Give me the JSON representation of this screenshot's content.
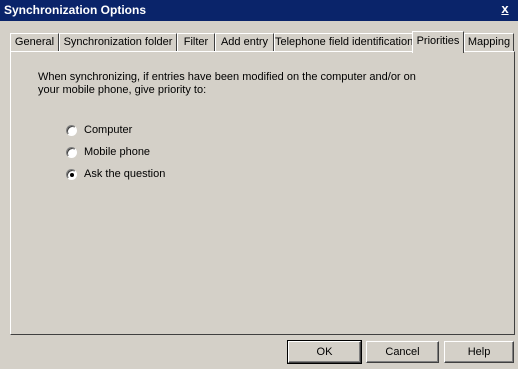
{
  "window": {
    "title": "Synchronization Options",
    "close_glyph": "x"
  },
  "tabs": [
    {
      "label": "General",
      "active": false
    },
    {
      "label": "Synchronization folder",
      "active": false
    },
    {
      "label": "Filter",
      "active": false
    },
    {
      "label": "Add entry",
      "active": false
    },
    {
      "label": "Telephone field identification",
      "active": false
    },
    {
      "label": "Priorities",
      "active": true
    },
    {
      "label": "Mapping",
      "active": false
    }
  ],
  "priorities": {
    "instructions": "When synchronizing, if entries have been modified on the computer and/or on your mobile phone, give priority to:",
    "options": [
      {
        "label": "Computer",
        "checked": false
      },
      {
        "label": "Mobile phone",
        "checked": false
      },
      {
        "label": "Ask the question",
        "checked": true
      }
    ]
  },
  "buttons": {
    "ok": "OK",
    "cancel": "Cancel",
    "help": "Help"
  },
  "colors": {
    "titlebar": "#0a246a",
    "face": "#d4d0c8"
  },
  "icons": {
    "close": "close-icon",
    "radio": "radio-button"
  }
}
